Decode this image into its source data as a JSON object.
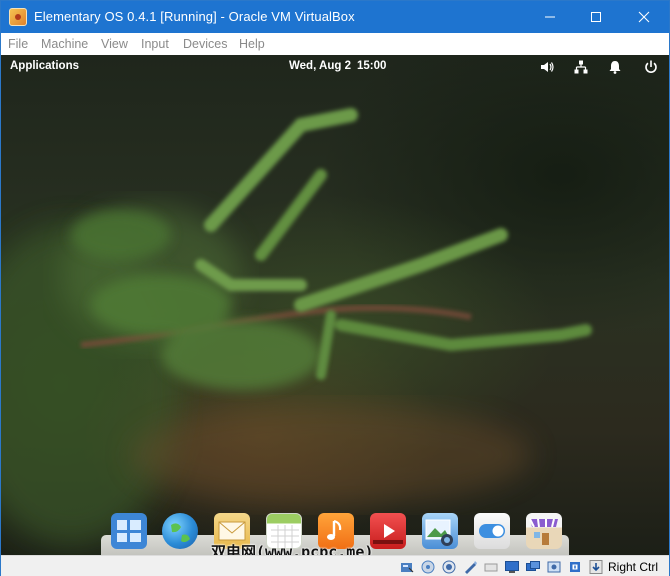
{
  "window": {
    "title": "Elementary OS 0.4.1 [Running] - Oracle VM VirtualBox"
  },
  "menubar": {
    "items": [
      "File",
      "Machine",
      "View",
      "Input",
      "Devices",
      "Help"
    ]
  },
  "guest": {
    "panel": {
      "applications_label": "Applications",
      "date": "Wed, Aug  2",
      "time": "15:00",
      "tray_icons": [
        "volume-icon",
        "network-icon",
        "notifications-icon",
        "power-icon"
      ]
    },
    "dock": {
      "apps": [
        "multitasking-view",
        "web-browser",
        "mail",
        "calendar",
        "music",
        "videos",
        "photos",
        "system-settings",
        "appcenter"
      ]
    },
    "watermark": "双电网(www.pcpc.me)"
  },
  "statusbar": {
    "icons": [
      "hard-disk-icon",
      "optical-drive-icon",
      "audio-icon",
      "network-adapter-icon",
      "usb-icon",
      "shared-folders-icon",
      "display-icon",
      "capture-icon",
      "cpu-icon",
      "virtualization-icon",
      "mouse-integration-icon"
    ],
    "host_key": "Right Ctrl"
  },
  "colors": {
    "titlebar": "#1e74d0",
    "menu_text": "#8a8a8a",
    "statusbar": "#f0f0f0"
  }
}
